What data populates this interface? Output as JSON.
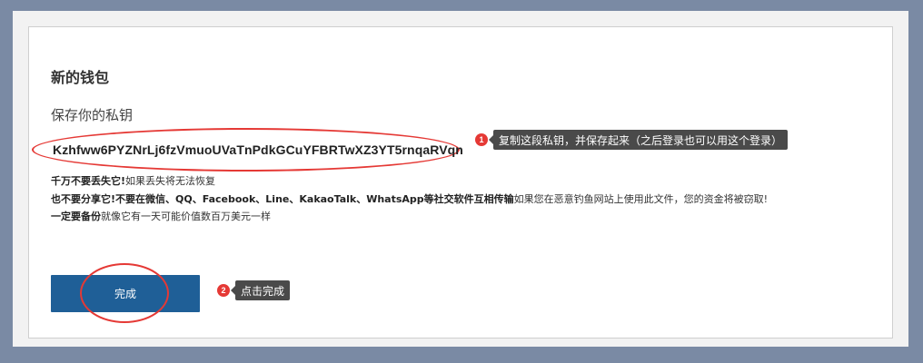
{
  "wallet": {
    "title": "新的钱包",
    "subtitle": "保存你的私钥",
    "private_key": "Kzhfww6PYZNrLj6fzVmuoUVaTnPdkGCuYFBRTwXZ3YT5rnqaRVqn"
  },
  "warnings": {
    "line1_bold": "千万不要丢失它!",
    "line1_text": "如果丢失将无法恢复",
    "line2_bold": "也不要分享它!不要在微信、QQ、Facebook、Line、KakaoTalk、WhatsApp等社交软件互相传输",
    "line2_text": "如果您在恶意钓鱼网站上使用此文件，您的资金将被窃取!",
    "line3_bold": "一定要备份",
    "line3_text": "就像它有一天可能价值数百万美元一样"
  },
  "done_button": {
    "label": "完成"
  },
  "annotations": {
    "step1": {
      "number": "1",
      "text": "复制这段私钥，并保存起来（之后登录也可以用这个登录）"
    },
    "step2": {
      "number": "2",
      "text": "点击完成"
    }
  },
  "colors": {
    "background": "#7a8aa4",
    "button": "#1f5f97",
    "highlight": "#e53935",
    "tooltip": "#4a4a4a"
  }
}
